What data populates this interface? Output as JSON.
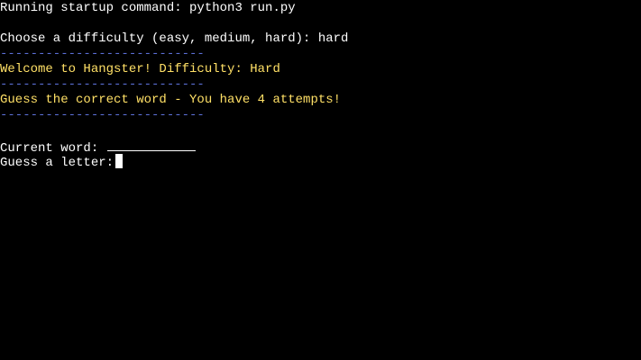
{
  "terminal": {
    "startup": "Running startup command: python3 run.py",
    "difficulty_prompt": "Choose a difficulty (easy, medium, hard): hard",
    "separator": "---------------------------",
    "welcome": "Welcome to Hangster! Difficulty: Hard",
    "guess_info": "Guess the correct word - You have 4 attempts!",
    "current_word_label": "Current word:",
    "guess_prompt": "Guess a letter:"
  },
  "colors": {
    "background": "#000000",
    "text": "#ffffff",
    "highlight": "#ffe066",
    "separator": "#5b6fd6"
  }
}
